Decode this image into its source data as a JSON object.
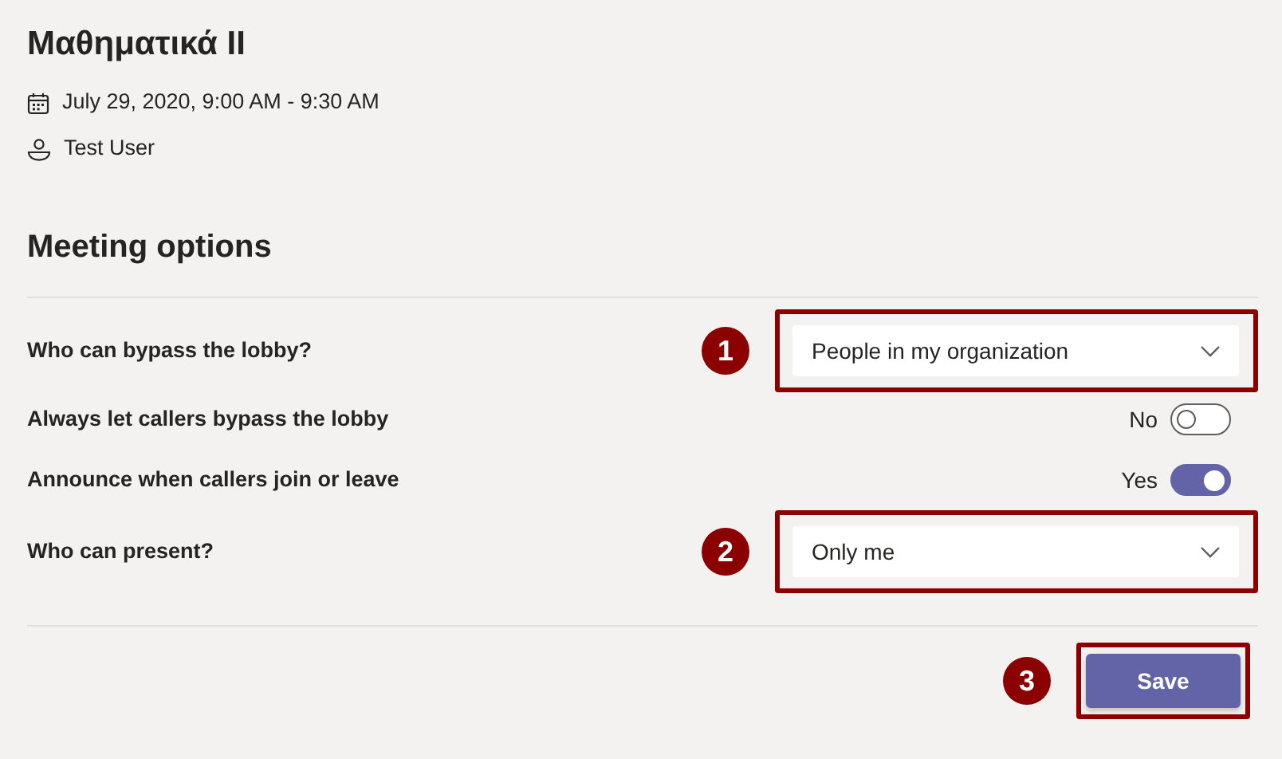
{
  "meeting": {
    "title": "Μαθηματικά II",
    "time": "July 29, 2020, 9:00 AM - 9:30 AM",
    "organizer": "Test User"
  },
  "section_title": "Meeting options",
  "options": [
    {
      "kind": "dropdown",
      "label": "Who can bypass the lobby?",
      "value": "People in my organization",
      "callout": "1"
    },
    {
      "kind": "toggle",
      "label": "Always let callers bypass the lobby",
      "on": false,
      "reading": "No"
    },
    {
      "kind": "toggle",
      "label": "Announce when callers join or leave",
      "on": true,
      "reading": "Yes"
    },
    {
      "kind": "dropdown",
      "label": "Who can present?",
      "value": "Only me",
      "callout": "2"
    }
  ],
  "save": {
    "label": "Save",
    "callout": "3"
  }
}
